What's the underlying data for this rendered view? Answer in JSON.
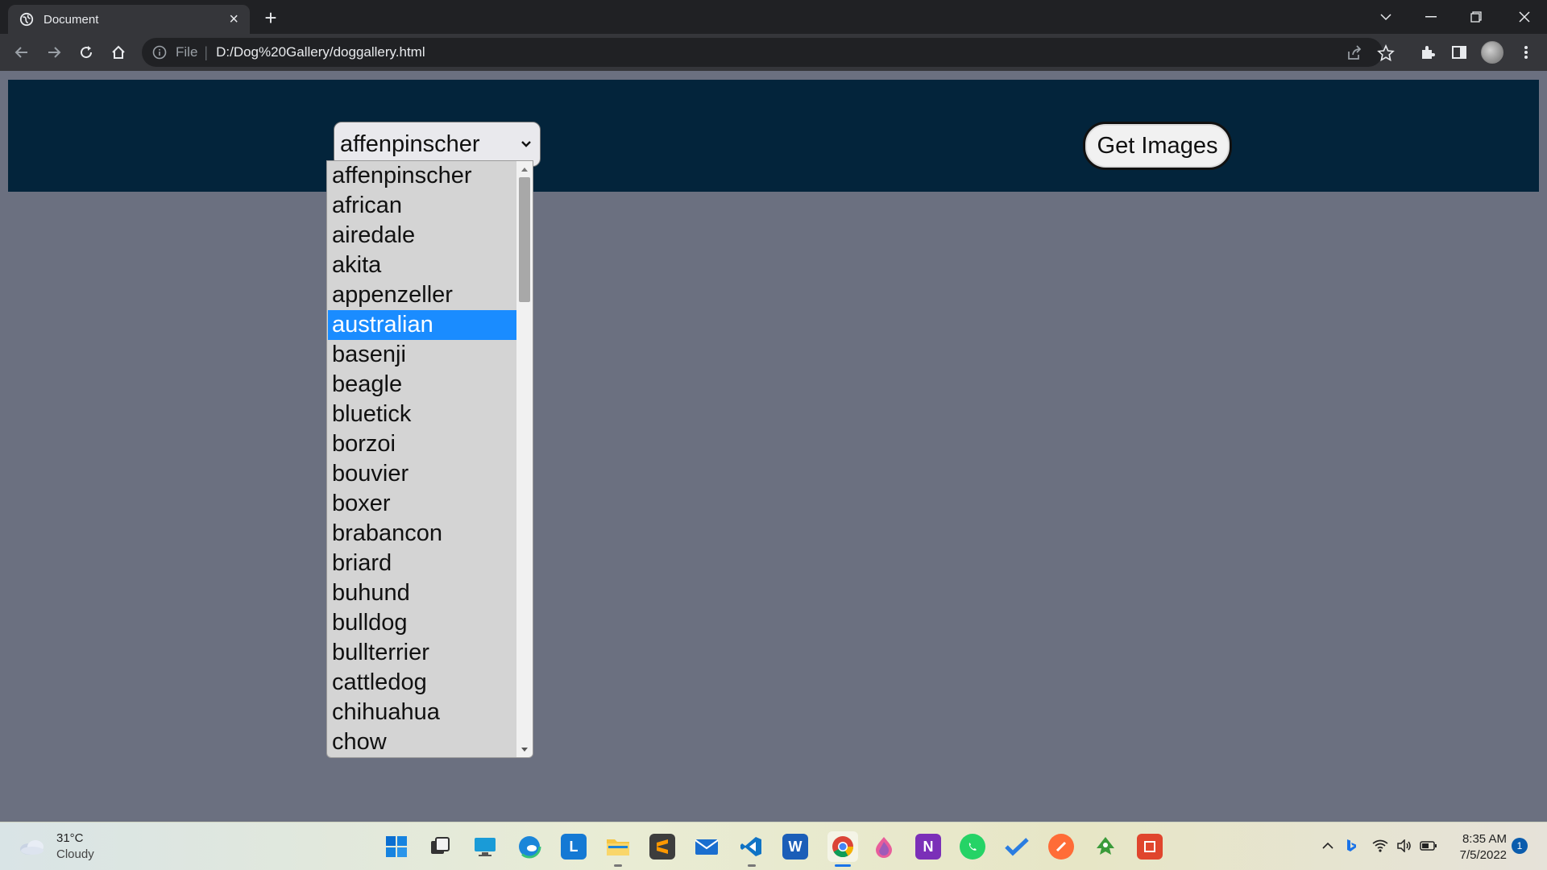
{
  "browser": {
    "tab_title": "Document",
    "new_tab_symbol": "+",
    "close_tab_symbol": "×",
    "address_scheme": "File",
    "address_url": "D:/Dog%20Gallery/doggallery.html"
  },
  "page": {
    "select_value": "affenpinscher",
    "button_label": "Get Images",
    "breed_options": [
      "affenpinscher",
      "african",
      "airedale",
      "akita",
      "appenzeller",
      "australian",
      "basenji",
      "beagle",
      "bluetick",
      "borzoi",
      "bouvier",
      "boxer",
      "brabancon",
      "briard",
      "buhund",
      "bulldog",
      "bullterrier",
      "cattledog",
      "chihuahua",
      "chow"
    ],
    "highlighted_option": "australian"
  },
  "taskbar": {
    "temperature": "31°C",
    "condition": "Cloudy",
    "time": "8:35 AM",
    "date": "7/5/2022",
    "notification_count": "1",
    "apps": [
      "start",
      "task-view",
      "desktop",
      "edge",
      "l-app",
      "file-explorer",
      "sublime-text",
      "mail",
      "vscode",
      "word",
      "chrome",
      "paint",
      "onenote",
      "whatsapp",
      "todo",
      "postman",
      "inkscape",
      "app-red"
    ]
  },
  "colors": {
    "header_band": "#03243b",
    "page_background": "#6b7080",
    "option_highlight": "#1a8cff"
  }
}
